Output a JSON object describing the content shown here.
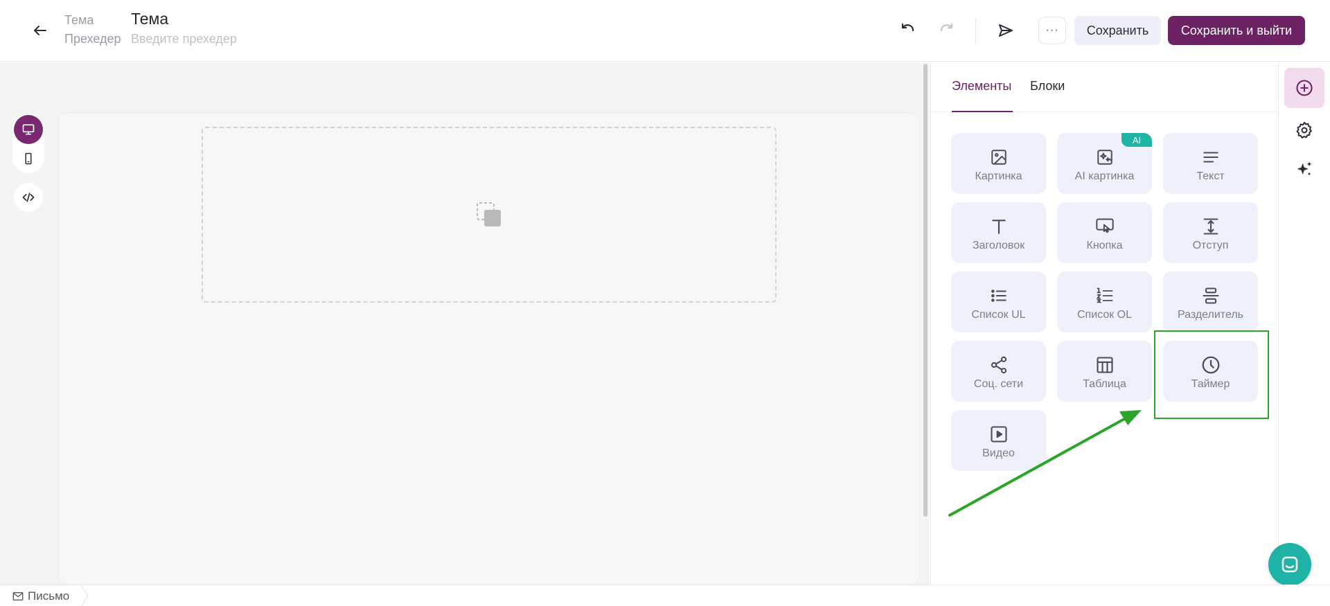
{
  "header": {
    "subject_label": "Тема",
    "subject_value": "Тема",
    "preheader_label": "Прехедер",
    "preheader_placeholder": "Введите прехедер",
    "more_label": "···",
    "save_label": "Сохранить",
    "save_exit_label": "Сохранить и выйти"
  },
  "panel": {
    "tabs": [
      {
        "label": "Элементы",
        "active": true
      },
      {
        "label": "Блоки",
        "active": false
      }
    ],
    "tiles": [
      {
        "label": "Картинка",
        "icon": "image-icon"
      },
      {
        "label": "AI картинка",
        "icon": "ai-image-icon",
        "badge": "AI"
      },
      {
        "label": "Текст",
        "icon": "text-icon"
      },
      {
        "label": "Заголовок",
        "icon": "heading-icon"
      },
      {
        "label": "Кнопка",
        "icon": "button-icon"
      },
      {
        "label": "Отступ",
        "icon": "spacer-icon"
      },
      {
        "label": "Список UL",
        "icon": "bullet-list-icon"
      },
      {
        "label": "Список OL",
        "icon": "numbered-list-icon"
      },
      {
        "label": "Разделитель",
        "icon": "divider-icon"
      },
      {
        "label": "Соц. сети",
        "icon": "share-icon"
      },
      {
        "label": "Таблица",
        "icon": "table-icon"
      },
      {
        "label": "Таймер",
        "icon": "clock-icon"
      },
      {
        "label": "Видео",
        "icon": "video-icon"
      }
    ]
  },
  "footer": {
    "breadcrumb": "Письмо"
  },
  "colors": {
    "brand": "#6d2363",
    "tile_bg": "#eef1fb",
    "accent_teal": "#1fb5a4",
    "highlight": "#2aa52a"
  }
}
